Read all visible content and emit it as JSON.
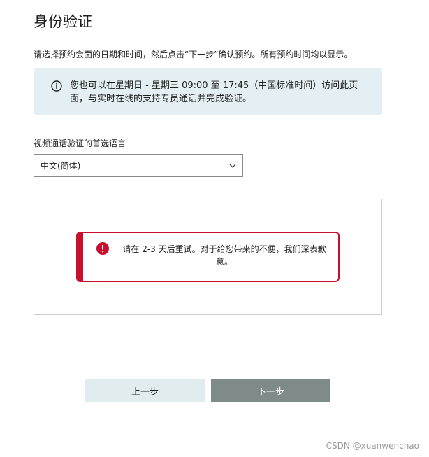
{
  "page": {
    "title": "身份验证",
    "instruction": "请选择预约会面的日期和时间，然后点击“下一步”确认预约。所有预约时间均以显示。"
  },
  "info_banner": {
    "icon": "info-circle-icon",
    "text": "您也可以在星期日 - 星期三 09:00 至 17:45（中国标准时间）访问此页面，与实时在线的支持专员通话并完成验证。"
  },
  "language": {
    "label": "视频通话验证的首选语言",
    "selected": "中文(简体)"
  },
  "error": {
    "icon": "exclamation-circle-icon",
    "text": "请在 2-3 天后重试。对于给您带来的不便，我们深表歉意。",
    "color": "#c8102e"
  },
  "buttons": {
    "prev_label": "上一步",
    "next_label": "下一步"
  },
  "watermark": "CSDN @xuanwenchao"
}
